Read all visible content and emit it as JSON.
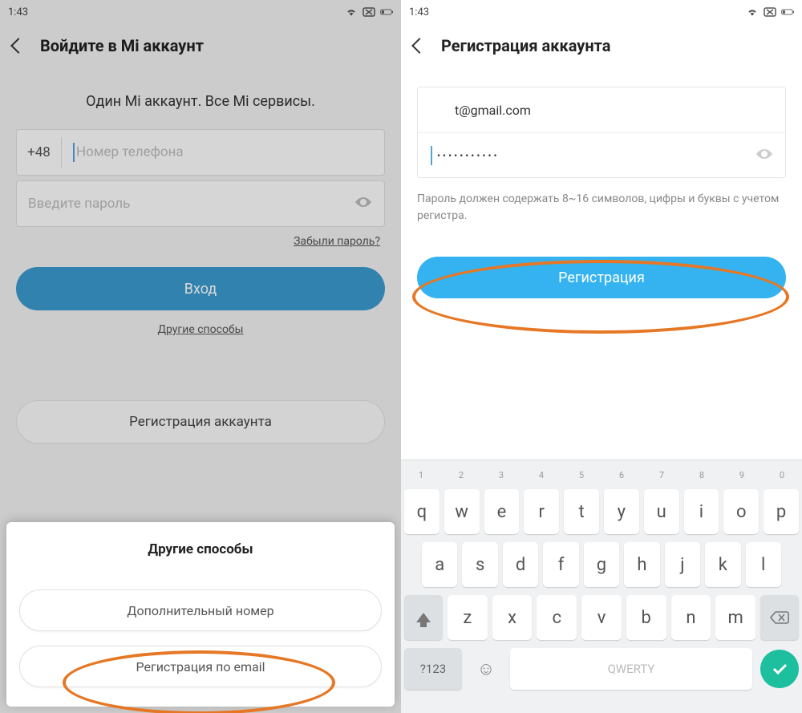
{
  "status": {
    "time": "1:43"
  },
  "left": {
    "header": "Войдите в Mi аккаунт",
    "tagline": "Один Mi аккаунт. Все Mi сервисы.",
    "prefix": "+48",
    "phone_ph": "Номер телефона",
    "password_ph": "Введите пароль",
    "forgot": "Забыли пароль?",
    "signin": "Вход",
    "other": "Другие способы",
    "register": "Регистрация аккаунта",
    "sheet": {
      "title": "Другие способы",
      "btn1": "Дополнительный номер",
      "btn2": "Регистрация по email"
    }
  },
  "right": {
    "header": "Регистрация аккаунта",
    "email": "t@gmail.com",
    "password": "•••••••••••",
    "hint": "Пароль должен содержать 8~16 символов, цифры и буквы с учетом регистра.",
    "register": "Регистрация"
  },
  "keyboard": {
    "hints": [
      "1",
      "2",
      "3",
      "4",
      "5",
      "6",
      "7",
      "8",
      "9",
      "0"
    ],
    "row1": [
      "q",
      "w",
      "e",
      "r",
      "t",
      "y",
      "u",
      "i",
      "o",
      "p"
    ],
    "row2": [
      "a",
      "s",
      "d",
      "f",
      "g",
      "h",
      "j",
      "k",
      "l"
    ],
    "row3": [
      "z",
      "x",
      "c",
      "v",
      "b",
      "n",
      "m"
    ],
    "num": "?123",
    "space": "QWERTY"
  }
}
